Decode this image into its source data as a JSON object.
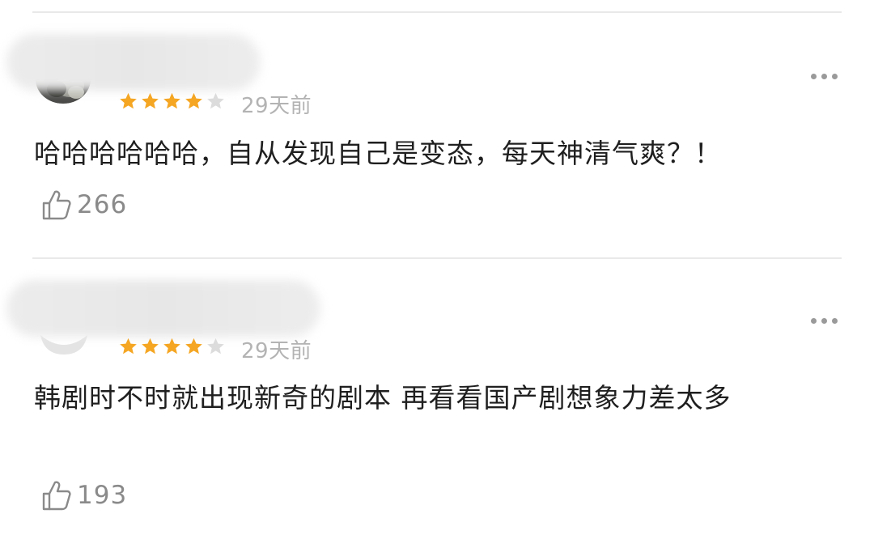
{
  "comments": [
    {
      "rating": 4,
      "max_rating": 5,
      "time": "29天前",
      "text": "哈哈哈哈哈哈，自从发现自己是变态，每天神清气爽？！",
      "likes": "266"
    },
    {
      "rating": 4,
      "max_rating": 5,
      "time": "29天前",
      "text": "韩剧时不时就出现新奇的剧本 再看看国产剧想象力差太多",
      "likes": "193"
    }
  ],
  "colors": {
    "star_filled": "#f5a623",
    "star_empty": "#dcdcdc",
    "time_text": "#b3b3b3",
    "body_text": "#1f1f1f",
    "like_text": "#8a8a8a"
  },
  "icons": {
    "more": "more-dots-icon",
    "like": "thumbs-up-icon",
    "star": "star-icon"
  }
}
